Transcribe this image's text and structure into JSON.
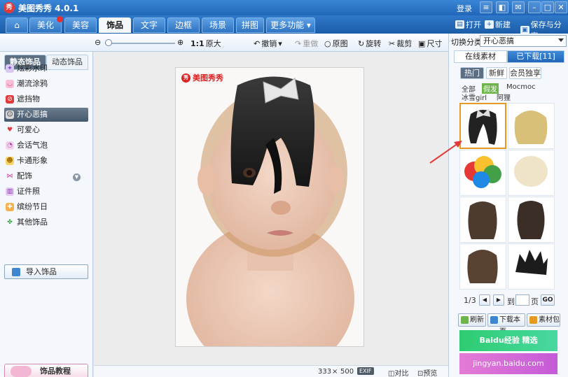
{
  "app": {
    "title": "美图秀秀 4.0.1",
    "logo_text": "秀",
    "login": "登录"
  },
  "tabs": [
    "美化",
    "美容",
    "饰品",
    "文字",
    "边框",
    "场景",
    "拼图",
    "更多功能"
  ],
  "right_tools": {
    "open": "打开",
    "new": "新建",
    "save": "保存与分享"
  },
  "toolbar": {
    "zoom_label": "1:1",
    "original_size": "原大",
    "undo": "撤销",
    "redo": "重做",
    "original": "原图",
    "rotate": "旋转",
    "crop": "裁剪",
    "resize": "尺寸"
  },
  "left_panel": {
    "tab_static": "静态饰品",
    "tab_dynamic": "动态饰品",
    "items": [
      "炫彩水印",
      "潮流涂鸦",
      "遮挡物",
      "开心恶搞",
      "可爱心",
      "会话气泡",
      "卡通形象",
      "配饰",
      "证件照",
      "缤纷节日",
      "其他饰品"
    ],
    "import_label": "导入饰品",
    "tutorial_label": "饰品教程"
  },
  "canvas": {
    "watermark": "美图秀秀",
    "width_px": "333",
    "height_px": "500",
    "times": "×",
    "exif": "EXIF",
    "compare": "对比",
    "preview": "预览"
  },
  "right_panel": {
    "category_label": "切换分类",
    "category_value": "开心恶搞",
    "tab_online": "在线素材",
    "tab_downloaded": "已下载[11]",
    "subtabs": [
      "热门",
      "新鲜",
      "会员独享"
    ],
    "tags": [
      "全部",
      "假发",
      "Mocmoc",
      "冰雪girl",
      "阿狸"
    ],
    "page_current": "1/3",
    "page_to": "到",
    "page_unit": "页",
    "go": "GO",
    "refresh": "刷新",
    "download_page": "下载本页",
    "material_pack": "素材包",
    "ad_top": "Baidu经验 精选",
    "ad_bottom": "jingyan.baidu.com"
  },
  "colors": {
    "accent": "#2166b8",
    "selection": "#e59a24",
    "red_arrow": "#e23a3a"
  }
}
